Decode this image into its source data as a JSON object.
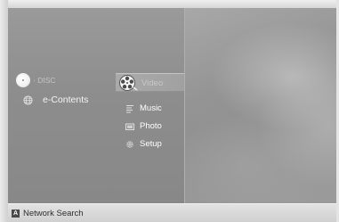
{
  "devices": {
    "disc": {
      "chip_text": "DISC",
      "label": "· DISC",
      "icon": "disc-icon"
    },
    "econtents": {
      "label": "e-Contents",
      "icon": "globe-icon"
    }
  },
  "menu": {
    "selected": "Video",
    "items": [
      {
        "label": "Video",
        "icon": "film-reel-icon"
      },
      {
        "label": "Music",
        "icon": "music-note-icon"
      },
      {
        "label": "Photo",
        "icon": "photo-icon"
      },
      {
        "label": "Setup",
        "icon": "gear-icon"
      }
    ]
  },
  "bottom_bar": {
    "button_key": "A",
    "label": "Network Search"
  },
  "colors": {
    "panel": "#8f8f8f",
    "frame": "#d6d6d6",
    "highlight": "#b5b5b5",
    "text": "#ffffff",
    "bottom_text": "#2e2e2e"
  }
}
